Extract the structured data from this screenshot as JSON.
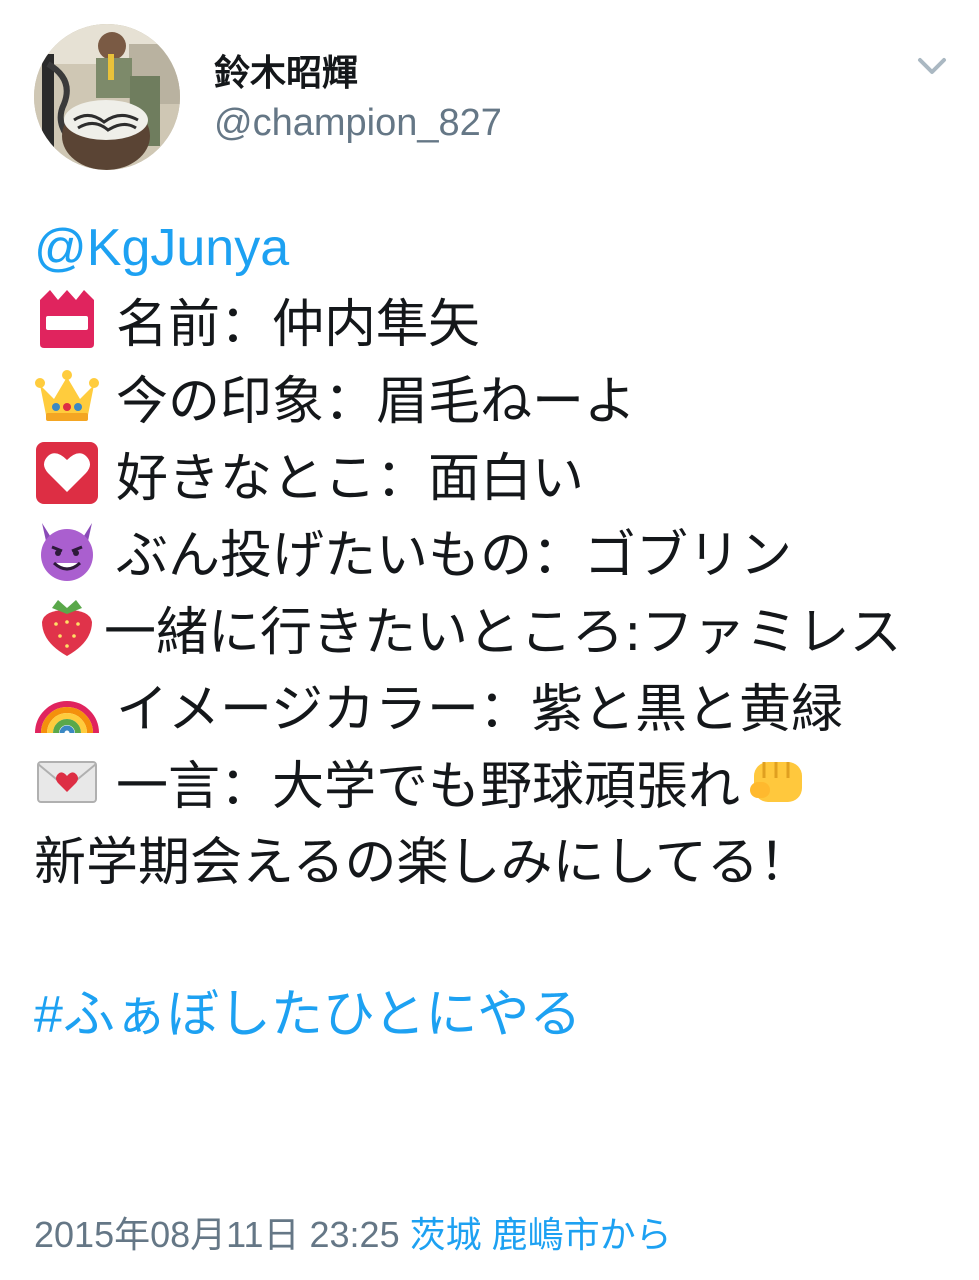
{
  "user": {
    "display_name": "鈴木昭輝",
    "handle": "@champion_827"
  },
  "header": {
    "menu_icon": "chevron-down-icon"
  },
  "tweet": {
    "mention": "@KgJunya",
    "lines": [
      {
        "icon": "name-badge-icon",
        "text": "名前：仲内隼矢"
      },
      {
        "icon": "crown-icon",
        "text": "今の印象：眉毛ねーよ"
      },
      {
        "icon": "white-heart-icon",
        "text": "好きなとこ：面白い"
      },
      {
        "icon": "smiling-devil-icon",
        "text": "ぶん投げたいもの：ゴブリン"
      },
      {
        "icon": "strawberry-icon",
        "text": "一緒に行きたいところ:ファミレス"
      },
      {
        "icon": "rainbow-icon",
        "text": "イメージカラー：紫と黒と黄緑"
      },
      {
        "icon": "love-letter-icon",
        "text": "一言：大学でも野球頑張れ",
        "end_icon": "fist-icon",
        "after": "新学期会えるの楽しみにしてる！"
      }
    ],
    "hashtag": "#ふぁぼしたひとにやる",
    "timestamp": "2015年08月11日 23:25",
    "location": "茨城 鹿嶋市から"
  },
  "colors": {
    "link": "#1da1f2",
    "secondary_text": "#657786",
    "primary_text": "#14171a"
  }
}
